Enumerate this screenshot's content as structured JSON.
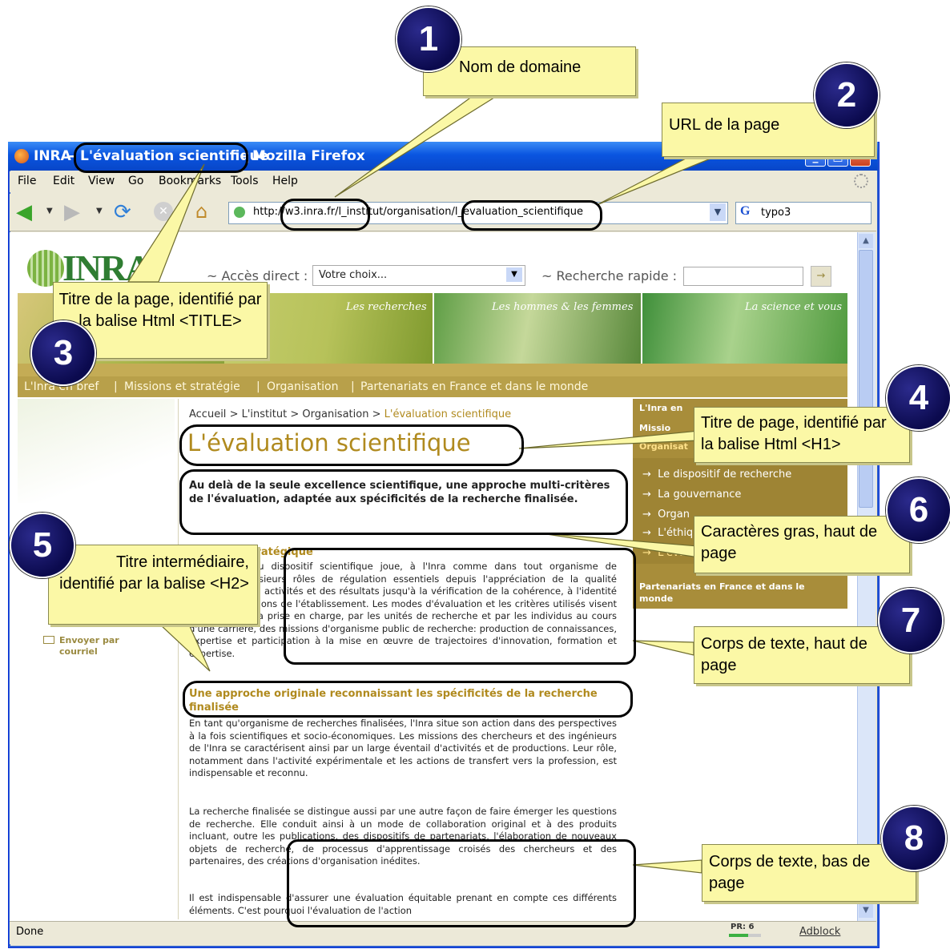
{
  "window": {
    "title_site": "INRA",
    "title_sep": "-",
    "title_page": "L'évaluation scientifique",
    "title_app": "- Mozilla Firefox"
  },
  "menu": [
    "File",
    "Edit",
    "View",
    "Go",
    "Bookmarks",
    "Tools",
    "Help"
  ],
  "address": {
    "url": "http://w3.inra.fr/l_institut/organisation/l_evaluation_scientifique",
    "search_engine": "G",
    "search_value": "typo3"
  },
  "page": {
    "logo": "INRA",
    "direct_label": "~ Accès direct :",
    "direct_value": "Votre choix...",
    "search_label": "~ Recherche rapide :",
    "banner": [
      "Les recherches",
      "Les hommes & les femmes",
      "La science et vous"
    ],
    "topnav": [
      "L'Inra en bref",
      "Missions et stratégie",
      "Organisation",
      "Partenariats en France et dans le monde"
    ],
    "breadcrumb_parts": [
      "Accueil",
      "L'institut",
      "Organisation"
    ],
    "breadcrumb_current": "L'évaluation scientifique",
    "h1": "L'évaluation scientifique",
    "intro": "Au delà de la seule excellence scientifique, une approche multi-critères de l'évaluation, adaptée aux spécificités de la recherche finalisée.",
    "h2a": "Un enjeu stratégique",
    "p1": "L'évaluation du dispositif scientifique joue, à l'Inra comme dans tout organisme de recherche, plusieurs rôles de régulation essentiels depuis l'appréciation de la qualité intrinsèque des activités et des résultats jusqu'à la vérification de la cohérence, à l'identité et aux orientations de l'établissement. Les modes d'évaluation et les critères utilisés visent à reconnaître la prise en charge, par les unités de recherche et par les individus au cours d'une carrière, des missions d'organisme public de recherche: production de connaissances, expertise et participation à la mise en œuvre de trajectoires d'innovation, formation et expertise.",
    "h2b": "Une approche originale reconnaissant les spécificités de la recherche finalisée",
    "p2": "En tant qu'organisme de recherches finalisées, l'Inra situe son action dans des perspectives à la fois scientifiques et socio-économiques. Les missions des chercheurs et des ingénieurs de l'Inra se caractérisent ainsi par un large éventail d'activités et de productions. Leur rôle, notamment dans l'activité expérimentale et les actions de transfert vers la profession, est indispensable et reconnu.",
    "p3": "La recherche finalisée se distingue aussi par une autre façon de faire émerger les questions de recherche. Elle conduit ainsi à un mode de collaboration original et à des produits incluant, outre les publications, des dispositifs de partenariats, l'élaboration de nouveaux objets de recherche, de processus d'apprentissage croisés des chercheurs et des partenaires, des créations d'organisation inédites.",
    "p4": "Il est indispensable d'assurer une évaluation équitable prenant en compte ces différents éléments. C'est pourquoi l'évaluation de l'action",
    "send": "Envoyer par courriel",
    "right_menu": {
      "top": [
        "L'Inra en",
        "Missio",
        "Organisat"
      ],
      "items": [
        "Le dispositif de recherche",
        "La gouvernance",
        "Organ",
        "L'éthiq",
        "L'éval"
      ],
      "bottom": "Partenariats en France et dans le monde"
    }
  },
  "status": {
    "left": "Done",
    "pr": "PR: 6",
    "adblock": "Adblock"
  },
  "callouts": {
    "c1": "Nom de domaine",
    "c2": "URL de la page",
    "c3": "Titre de la page, identifié par la balise Html <TITLE>",
    "c4": "Titre de page, identifié par la balise Html <H1>",
    "c5": "Titre intermédiaire, identifié par la balise <H2>",
    "c6": "Caractères gras, haut de page",
    "c7": "Corps de texte, haut de page",
    "c8": "Corps de texte, bas de page"
  },
  "badges": [
    "1",
    "2",
    "3",
    "4",
    "5",
    "6",
    "7",
    "8"
  ],
  "colors": {
    "gold": "#b8a04a",
    "olive": "#a88d3a",
    "h1": "#b08a1e",
    "callout": "#fbf8a6",
    "badge": "#0b0a4e"
  }
}
